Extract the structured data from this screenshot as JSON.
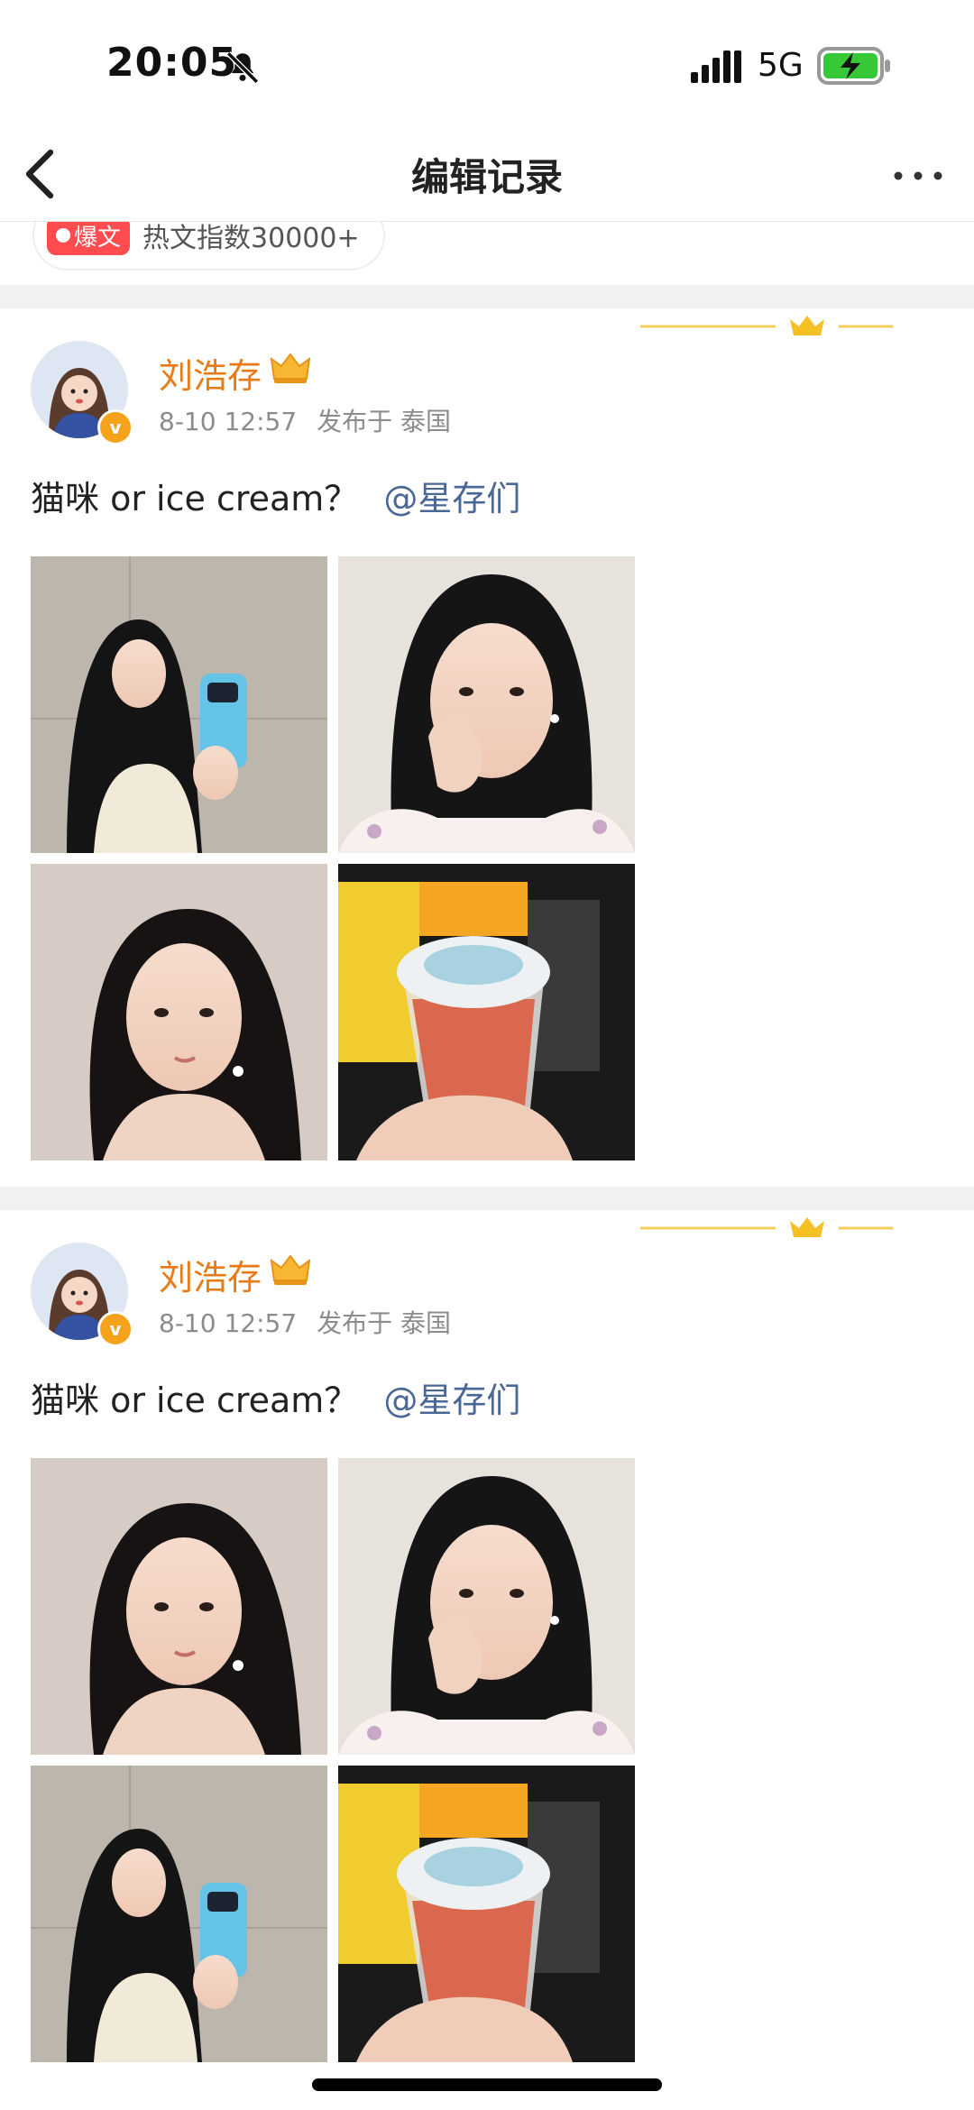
{
  "status_bar": {
    "time": "20:05",
    "network": "5G"
  },
  "nav": {
    "title": "编辑记录"
  },
  "previous_post": {
    "hot_tag": "爆文",
    "hot_text": "热文指数30000+"
  },
  "posts": [
    {
      "author": "刘浩存",
      "time": "8-10 12:57",
      "location": "发布于 泰国",
      "text": "猫咪 or ice cream？",
      "mention": "@星存们",
      "images": [
        "mirror-selfie-photo",
        "hand-on-cheek-photo",
        "portrait-photo",
        "ice-cream-photo"
      ]
    },
    {
      "author": "刘浩存",
      "time": "8-10 12:57",
      "location": "发布于 泰国",
      "text": "猫咪 or ice cream？",
      "mention": "@星存们",
      "images": [
        "portrait-photo",
        "hand-on-cheek-photo",
        "mirror-selfie-photo",
        "ice-cream-photo"
      ]
    }
  ],
  "colors": {
    "username": "#ea7a16",
    "mention": "#4a6896",
    "vip_badge": "#f7a21b",
    "divider": "#f2f2f2"
  }
}
